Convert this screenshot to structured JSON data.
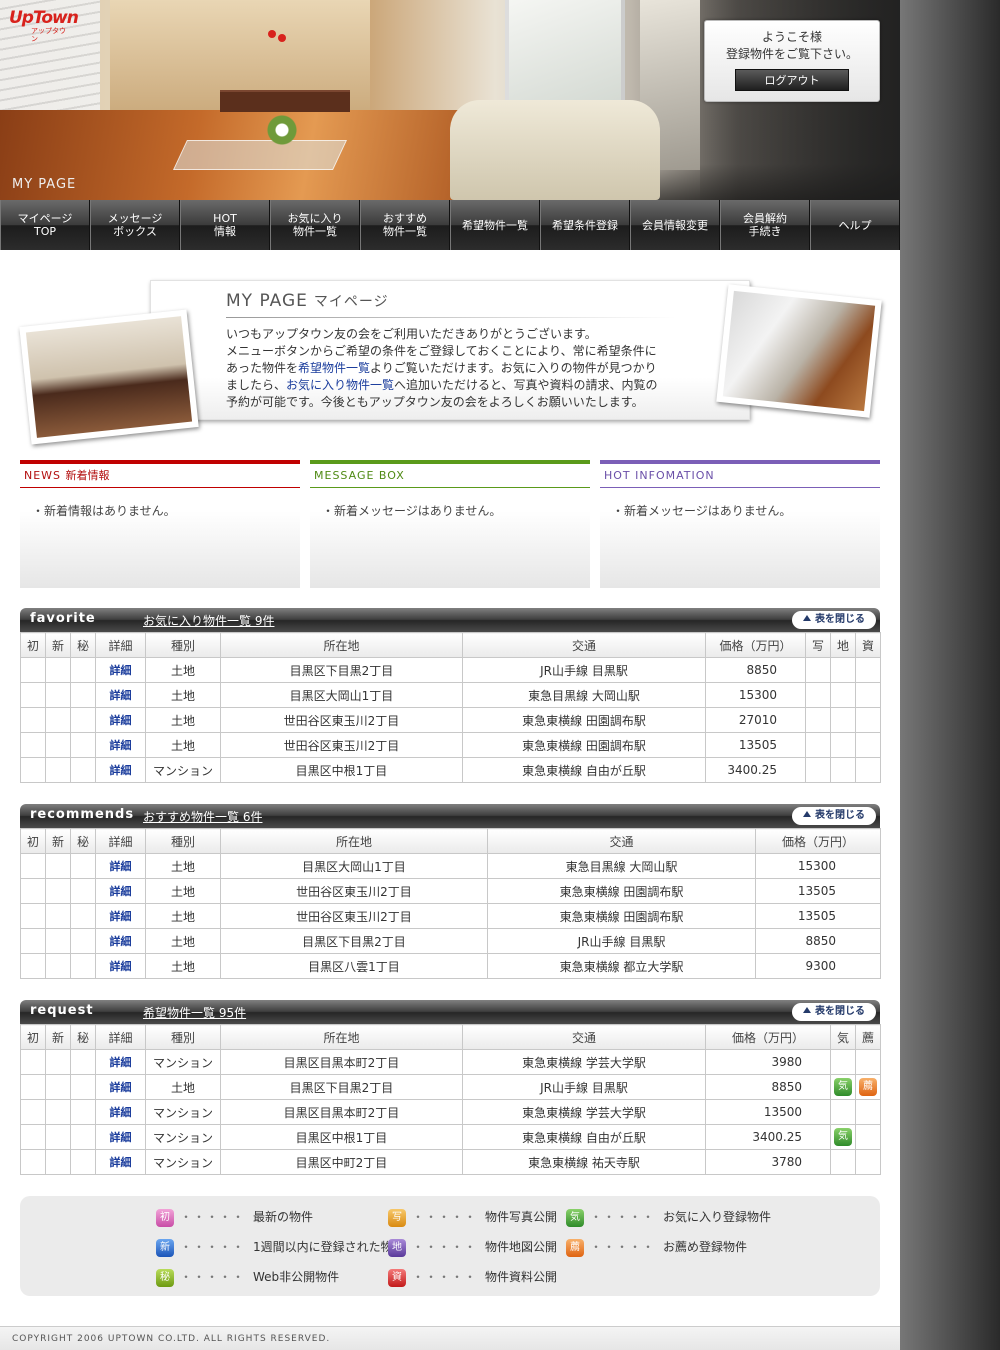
{
  "header": {
    "logo_text": "UpTown",
    "logo_sub": "アップタウン",
    "page_label": "MY PAGE",
    "welcome_line1": "ようこそ様",
    "welcome_line2": "登録物件をご覧下さい。",
    "logout_label": "ログアウト"
  },
  "nav": [
    "マイページ\nTOP",
    "メッセージ\nボックス",
    "HOT\n情報",
    "お気に入り\n物件一覧",
    "おすすめ\n物件一覧",
    "希望物件一覧",
    "希望条件登録",
    "会員情報変更",
    "会員解約\n手続き",
    "ヘルプ"
  ],
  "intro": {
    "title_en": "MY PAGE",
    "title_jp": "マイページ",
    "p1": "いつもアップタウン友の会をご利用いただきありがとうございます。",
    "p2": "メニューボタンからご希望の条件をご登録しておくことにより、常に希望条件に",
    "p3a": "あった物件を",
    "link1": "希望物件一覧",
    "p3b": "よりご覧いただけます。お気に入りの物件が見つかり",
    "p4a": "ましたら、",
    "link2": "お気に入り物件一覧",
    "p4b": "へ追加いただけると、写真や資料の請求、内覧の",
    "p5": "予約が可能です。今後ともアップタウン友の会をよろしくお願いいたします。"
  },
  "boxes": {
    "news": {
      "title_en": "NEWS",
      "title_jp": "新着情報",
      "body": "・新着情報はありません。"
    },
    "message": {
      "title_en": "MESSAGE BOX",
      "body": "・新着メッセージはありません。"
    },
    "hot": {
      "title_en": "HOT INFOMATION",
      "body": "・新着メッセージはありません。"
    }
  },
  "favorite": {
    "title": "favorite",
    "link": "お気に入り物件一覧 9件",
    "close": "表を閉じる",
    "headers": [
      "初",
      "新",
      "秘",
      "詳細",
      "種別",
      "所在地",
      "交通",
      "価格（万円）",
      "写",
      "地",
      "資"
    ],
    "rows": [
      [
        "",
        "",
        "",
        "詳細",
        "土地",
        "目黒区下目黒2丁目",
        "JR山手線 目黒駅",
        "8850",
        "",
        "",
        ""
      ],
      [
        "",
        "",
        "",
        "詳細",
        "土地",
        "目黒区大岡山1丁目",
        "東急目黒線 大岡山駅",
        "15300",
        "",
        "",
        ""
      ],
      [
        "",
        "",
        "",
        "詳細",
        "土地",
        "世田谷区東玉川2丁目",
        "東急東横線 田園調布駅",
        "27010",
        "",
        "",
        ""
      ],
      [
        "",
        "",
        "",
        "詳細",
        "土地",
        "世田谷区東玉川2丁目",
        "東急東横線 田園調布駅",
        "13505",
        "",
        "",
        ""
      ],
      [
        "",
        "",
        "",
        "詳細",
        "マンション",
        "目黒区中根1丁目",
        "東急東横線 自由が丘駅",
        "3400.25",
        "",
        "",
        ""
      ]
    ]
  },
  "recommends": {
    "title": "recommends",
    "link": "おすすめ物件一覧 6件",
    "close": "表を閉じる",
    "headers": [
      "初",
      "新",
      "秘",
      "詳細",
      "種別",
      "所在地",
      "交通",
      "価格（万円）"
    ],
    "rows": [
      [
        "",
        "",
        "",
        "詳細",
        "土地",
        "目黒区大岡山1丁目",
        "東急目黒線 大岡山駅",
        "15300"
      ],
      [
        "",
        "",
        "",
        "詳細",
        "土地",
        "世田谷区東玉川2丁目",
        "東急東横線 田園調布駅",
        "13505"
      ],
      [
        "",
        "",
        "",
        "詳細",
        "土地",
        "世田谷区東玉川2丁目",
        "東急東横線 田園調布駅",
        "13505"
      ],
      [
        "",
        "",
        "",
        "詳細",
        "土地",
        "目黒区下目黒2丁目",
        "JR山手線 目黒駅",
        "8850"
      ],
      [
        "",
        "",
        "",
        "詳細",
        "土地",
        "目黒区八雲1丁目",
        "東急東横線 都立大学駅",
        "9300"
      ]
    ]
  },
  "request": {
    "title": "request",
    "link": "希望物件一覧 95件",
    "close": "表を閉じる",
    "headers": [
      "初",
      "新",
      "秘",
      "詳細",
      "種別",
      "所在地",
      "交通",
      "価格（万円）",
      "気",
      "薦"
    ],
    "rows": [
      [
        "",
        "",
        "",
        "詳細",
        "マンション",
        "目黒区目黒本町2丁目",
        "東急東横線 学芸大学駅",
        "3980",
        "",
        ""
      ],
      [
        "",
        "",
        "",
        "詳細",
        "土地",
        "目黒区下目黒2丁目",
        "JR山手線 目黒駅",
        "8850",
        "気",
        "薦"
      ],
      [
        "",
        "",
        "",
        "詳細",
        "マンション",
        "目黒区目黒本町2丁目",
        "東急東横線 学芸大学駅",
        "13500",
        "",
        ""
      ],
      [
        "",
        "",
        "",
        "詳細",
        "マンション",
        "目黒区中根1丁目",
        "東急東横線 自由が丘駅",
        "3400.25",
        "気",
        ""
      ],
      [
        "",
        "",
        "",
        "詳細",
        "マンション",
        "目黒区中町2丁目",
        "東急東横線 祐天寺駅",
        "3780",
        "",
        ""
      ]
    ]
  },
  "legend": [
    {
      "badge": "初",
      "text": "最新の物件",
      "color": "pink"
    },
    {
      "badge": "新",
      "text": "1週間以内に登録された物件",
      "color": "blue"
    },
    {
      "badge": "秘",
      "text": "Web非公開物件",
      "color": "lime"
    },
    {
      "badge": "写",
      "text": "物件写真公開",
      "color": "gold"
    },
    {
      "badge": "地",
      "text": "物件地図公開",
      "color": "purple"
    },
    {
      "badge": "資",
      "text": "物件資料公開",
      "color": "red"
    },
    {
      "badge": "気",
      "text": "お気に入り登録物件",
      "color": "green"
    },
    {
      "badge": "薦",
      "text": "お薦め登録物件",
      "color": "orange"
    }
  ],
  "legend_dots": "・・・・・",
  "footer": "COPYRIGHT 2006 UPTOWN CO.LTD. ALL RIGHTS RESERVED."
}
